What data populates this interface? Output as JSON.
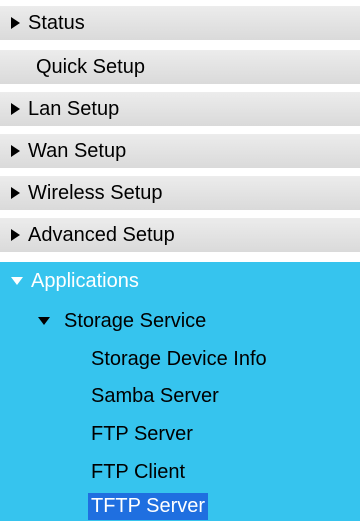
{
  "menu": {
    "status": "Status",
    "quick_setup": "Quick Setup",
    "lan_setup": "Lan Setup",
    "wan_setup": "Wan Setup",
    "wireless_setup": "Wireless Setup",
    "advanced_setup": "Advanced Setup",
    "applications": "Applications",
    "storage_service": "Storage Service",
    "storage_children": [
      "Storage Device Info",
      "Samba Server",
      "FTP Server",
      "FTP Client",
      "TFTP Server"
    ],
    "selected_item": "TFTP Server"
  },
  "colors": {
    "section_gray": "#e2e2e2",
    "applications_blue": "#36c4ee",
    "selected_highlight": "#1f6fe0"
  },
  "icons": {
    "collapsed": "triangle-right-icon",
    "expanded": "triangle-down-icon"
  }
}
